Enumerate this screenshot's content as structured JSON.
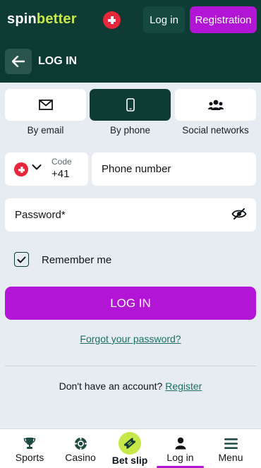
{
  "header": {
    "logo_spin": "spin",
    "logo_better": "better",
    "login_label": "Log in",
    "registration_label": "Registration"
  },
  "subheader": {
    "title": "LOG IN"
  },
  "tabs": [
    {
      "label": "By email",
      "icon": "envelope-icon",
      "active": false
    },
    {
      "label": "By phone",
      "icon": "phone-icon",
      "active": true
    },
    {
      "label": "Social networks",
      "icon": "users-icon",
      "active": false
    }
  ],
  "form": {
    "code_label": "Code",
    "code_value": "+41",
    "phone_placeholder": "Phone number",
    "password_placeholder": "Password*",
    "remember_label": "Remember me",
    "remember_checked": true,
    "submit_label": "LOG IN",
    "forgot_label": "Forgot your password?",
    "no_account_text": "Don't have an account?",
    "register_link": "Register"
  },
  "bottom_nav": {
    "items": [
      {
        "label": "Sports",
        "icon": "trophy-icon"
      },
      {
        "label": "Casino",
        "icon": "chip-icon"
      },
      {
        "label": "Bet slip",
        "icon": "ticket-icon"
      },
      {
        "label": "Log in",
        "icon": "user-icon",
        "active": true
      },
      {
        "label": "Menu",
        "icon": "menu-icon"
      }
    ]
  },
  "colors": {
    "header_bg": "#0e3b33",
    "accent_purple": "#b315d6",
    "accent_lime": "#c8e84a",
    "page_bg": "#e6ecf1",
    "link": "#1b6f66"
  }
}
